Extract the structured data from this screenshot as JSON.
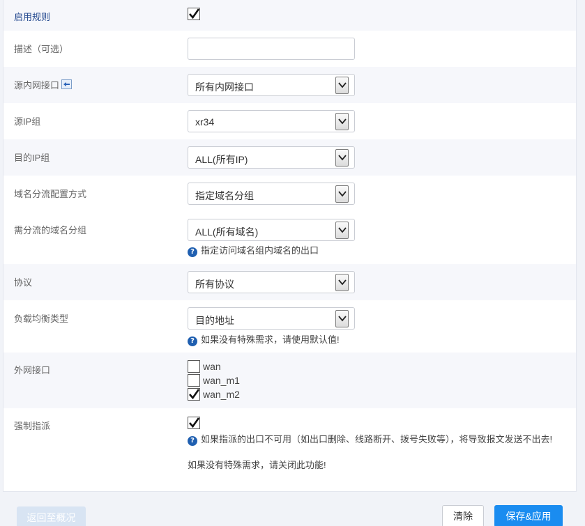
{
  "form": {
    "enable_rule": {
      "label": "启用规则",
      "checked": true
    },
    "description": {
      "label": "描述（可选）",
      "value": ""
    },
    "source_interface": {
      "label": "源内网接口",
      "icon": "back-arrow-icon",
      "value": "所有内网接口"
    },
    "source_ip_group": {
      "label": "源IP组",
      "value": "xr34"
    },
    "dest_ip_group": {
      "label": "目的IP组",
      "value": "ALL(所有IP)"
    },
    "domain_mode": {
      "label": "域名分流配置方式",
      "value": "指定域名分组"
    },
    "domain_group": {
      "label": "需分流的域名分组",
      "value": "ALL(所有域名)",
      "hint": "指定访问域名组内域名的出口"
    },
    "protocol": {
      "label": "协议",
      "value": "所有协议"
    },
    "lb_type": {
      "label": "负载均衡类型",
      "value": "目的地址",
      "hint": "如果没有特殊需求，请使用默认值!"
    },
    "wan": {
      "label": "外网接口",
      "options": [
        {
          "name": "wan",
          "checked": false
        },
        {
          "name": "wan_m1",
          "checked": false
        },
        {
          "name": "wan_m2",
          "checked": true
        }
      ]
    },
    "force": {
      "label": "强制指派",
      "checked": true,
      "hint1": "如果指派的出口不可用（如出口删除、线路断开、拨号失败等），将导致报文发送不出去!",
      "hint2": "如果没有特殊需求，请关闭此功能!"
    }
  },
  "buttons": {
    "back": "返回至概况",
    "clear": "清除",
    "save": "保存&应用"
  },
  "colors": {
    "primary": "#1a8cf0",
    "label_blue": "#24498f",
    "help_icon": "#1f5fb0"
  }
}
